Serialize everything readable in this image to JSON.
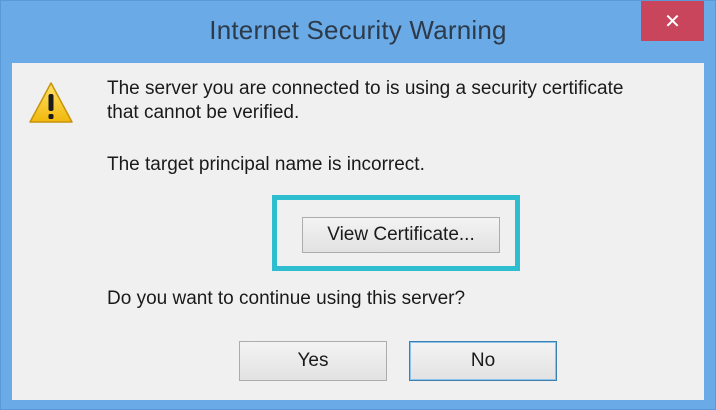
{
  "window": {
    "title": "Internet Security Warning",
    "close_label": "✕"
  },
  "dialog": {
    "icon": "warning-icon",
    "message_line1": "The server you are connected to is using a security certificate",
    "message_line2": "that cannot be verified.",
    "detail": "The target principal name is incorrect.",
    "question": "Do you want to continue using this server?"
  },
  "buttons": {
    "view_certificate": "View Certificate...",
    "yes": "Yes",
    "no": "No"
  },
  "colors": {
    "titlebar": "#6aaae6",
    "close": "#c9455c",
    "highlight": "#2fbdd0",
    "warning": "#f5c518"
  }
}
